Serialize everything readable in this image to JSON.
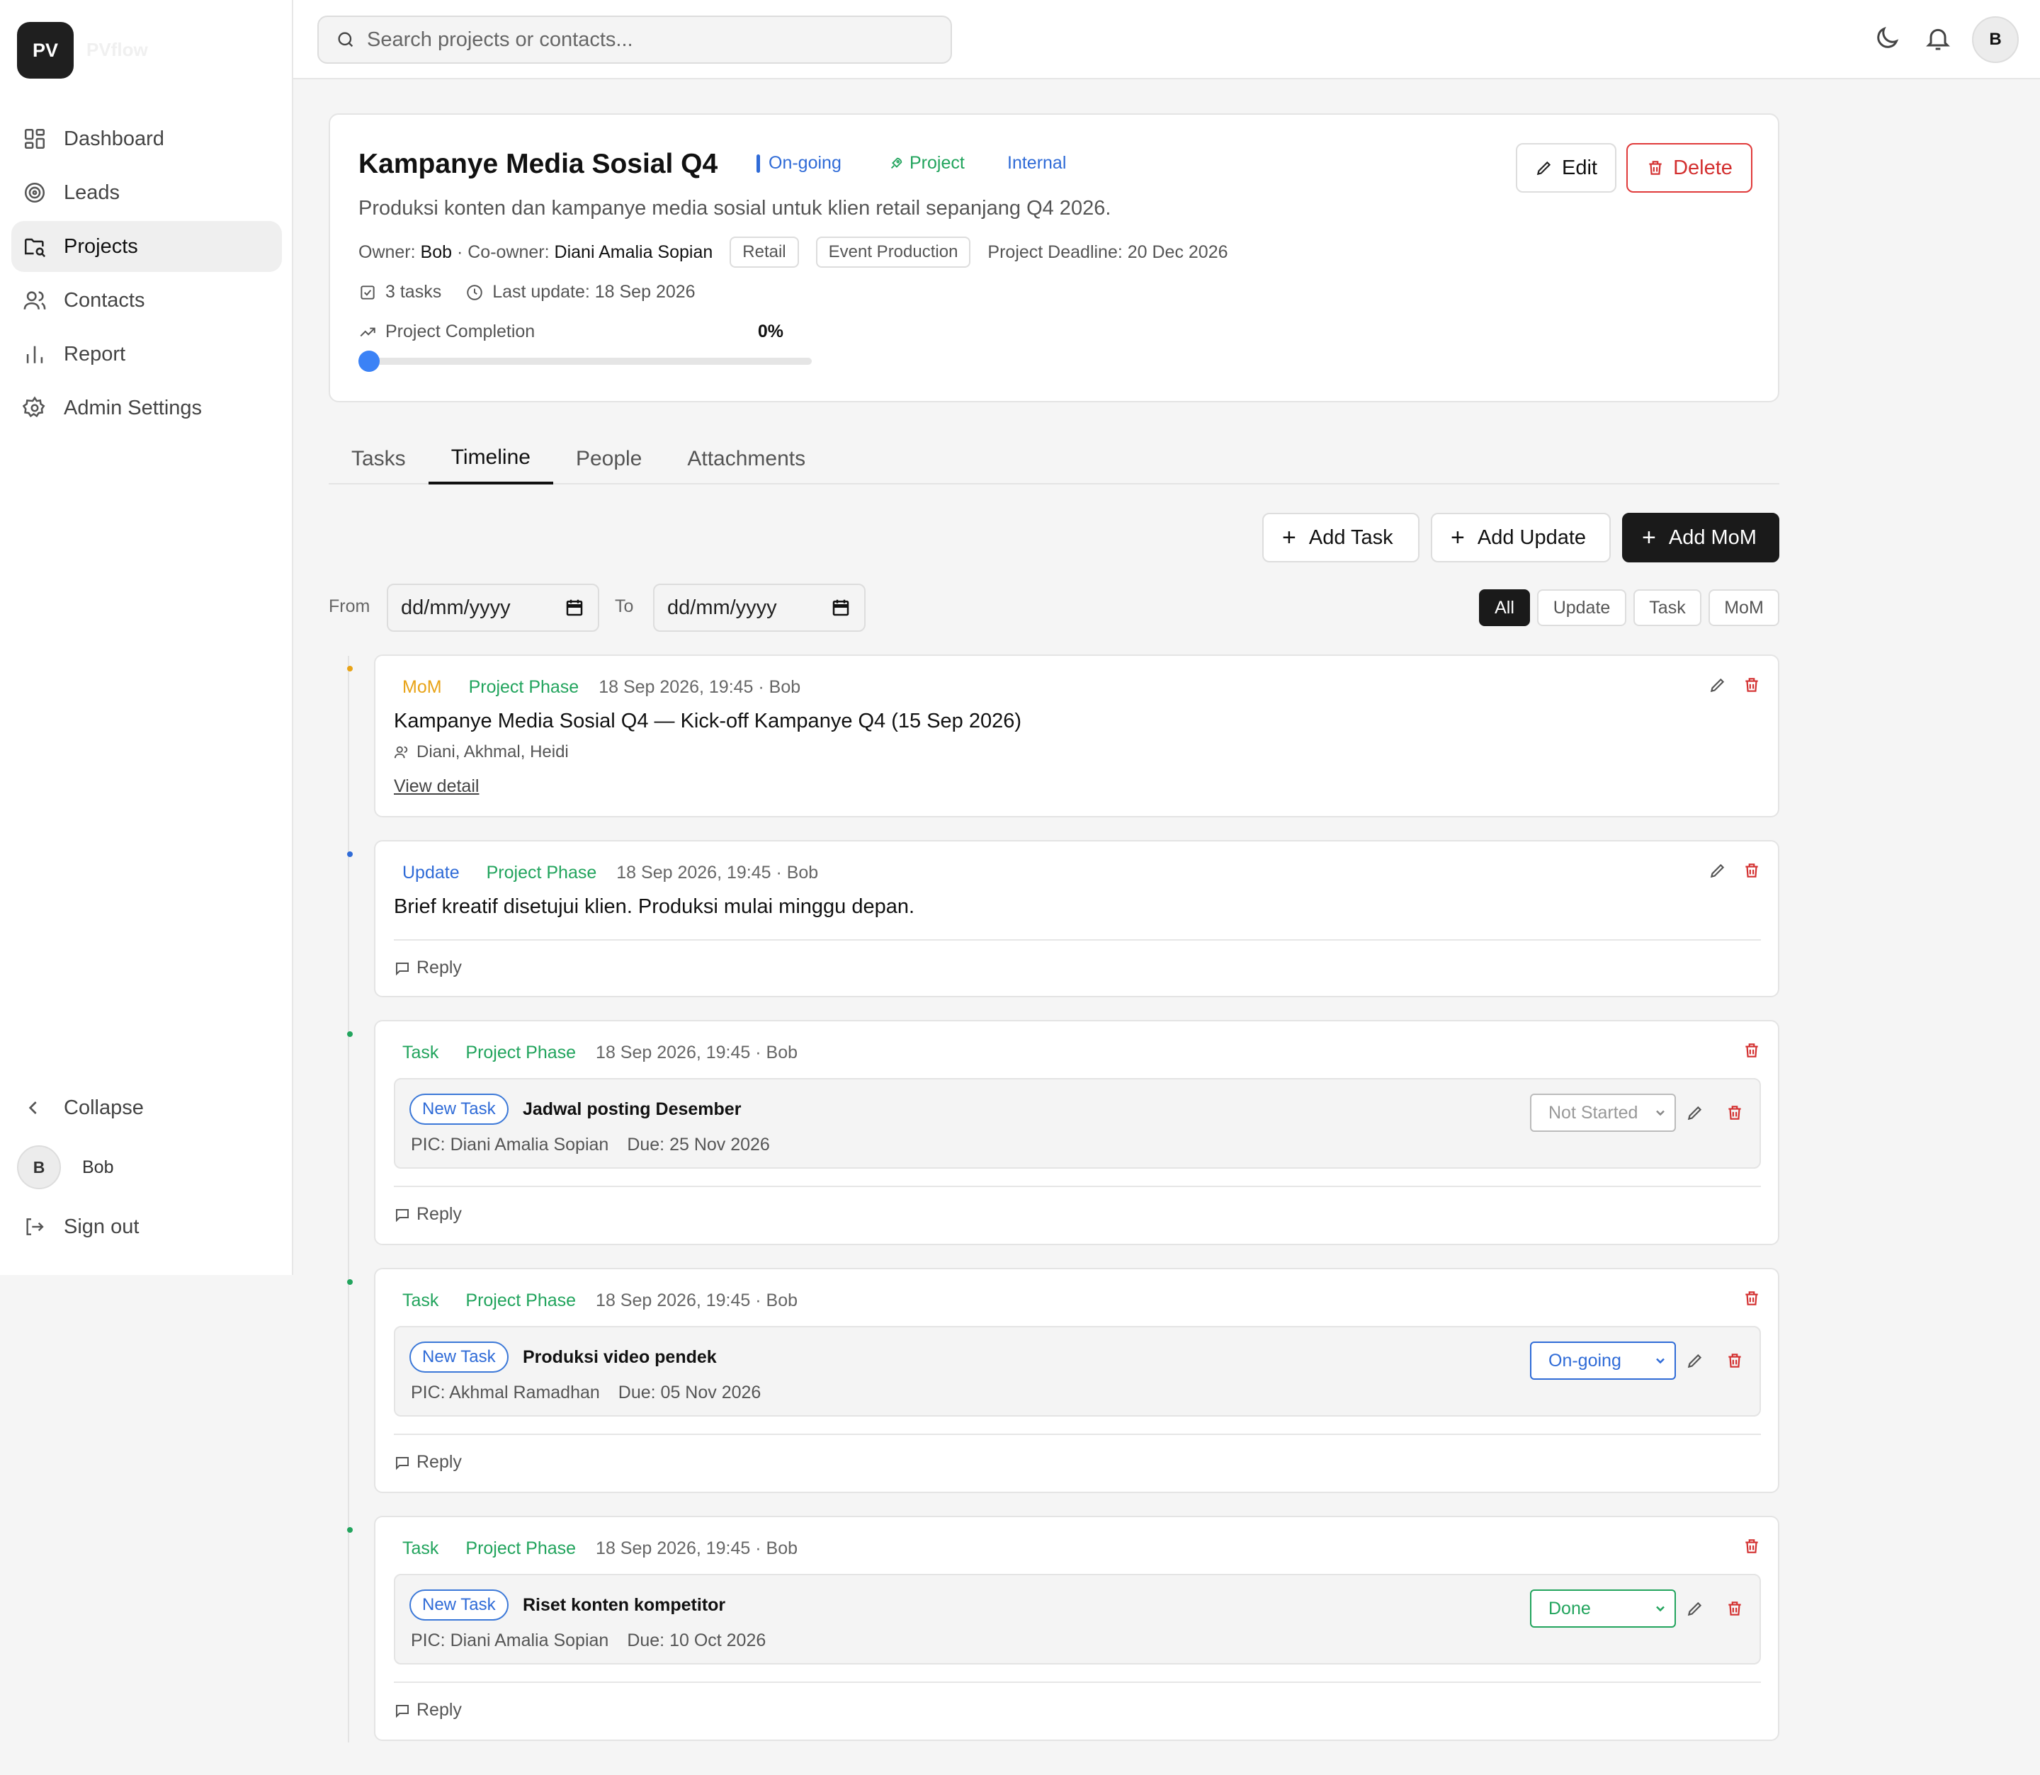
{
  "app": {
    "logo": "PV",
    "logo_text": "PVflow"
  },
  "sidebar": {
    "items": [
      {
        "label": "Dashboard",
        "icon": "dashboard-icon"
      },
      {
        "label": "Leads",
        "icon": "target-icon"
      },
      {
        "label": "Projects",
        "icon": "folder-icon"
      },
      {
        "label": "Contacts",
        "icon": "users-icon"
      },
      {
        "label": "Report",
        "icon": "bar-chart-icon"
      },
      {
        "label": "Admin Settings",
        "icon": "gear-icon"
      }
    ],
    "collapse": "Collapse",
    "user_initial": "B",
    "user_name": "Bob",
    "sign_out": "Sign out"
  },
  "topbar": {
    "search_placeholder": "Search projects or contacts...",
    "avatar": "B"
  },
  "project": {
    "title": "Kampanye Media Sosial Q4",
    "status": "On-going",
    "type": "Project",
    "scope": "Internal",
    "description": "Produksi konten dan kampanye media sosial untuk klien retail sepanjang Q4 2026.",
    "owner_label": "Owner:",
    "owner": "Bob",
    "coowner_label": "· Co-owner:",
    "coowner": "Diani Amalia Sopian",
    "tags": [
      "Retail",
      "Event Production"
    ],
    "deadline": "Project Deadline: 20 Dec 2026",
    "tasks_count": "3 tasks",
    "last_update": "Last update: 18 Sep 2026",
    "completion_label": "Project Completion",
    "completion_text": "0%",
    "completion_value": 0,
    "edit": "Edit",
    "delete": "Delete"
  },
  "tabs": [
    "Tasks",
    "Timeline",
    "People",
    "Attachments"
  ],
  "actions": {
    "add_task": "Add Task",
    "add_update": "Add Update",
    "add_mom": "Add MoM"
  },
  "filters": {
    "from": "From",
    "to": "To",
    "date_placeholder": "dd/mm/yyyy",
    "segments": [
      "All",
      "Update",
      "Task",
      "MoM"
    ]
  },
  "colors": {
    "mom": "#e8a317",
    "update": "#2f6bd7",
    "task": "#22a45d",
    "danger": "#d32f2f"
  },
  "timeline": [
    {
      "type": "MoM",
      "phase": "Project Phase",
      "time": "18 Sep 2026, 19:45 · Bob",
      "title": "Kampanye Media Sosial Q4 — Kick-off Kampanye Q4 (15 Sep 2026)",
      "people": "Diani, Akhmal, Heidi",
      "link": "View detail"
    },
    {
      "type": "Update",
      "phase": "Project Phase",
      "time": "18 Sep 2026, 19:45 · Bob",
      "text": "Brief kreatif disetujui klien. Produksi mulai minggu depan.",
      "reply": "Reply"
    },
    {
      "type": "Task",
      "phase": "Project Phase",
      "time": "18 Sep 2026, 19:45 · Bob",
      "badge": "New Task",
      "name": "Jadwal posting Desember",
      "pic": "PIC: Diani Amalia Sopian",
      "due": "Due: 25 Nov 2026",
      "status": "Not Started",
      "reply": "Reply"
    },
    {
      "type": "Task",
      "phase": "Project Phase",
      "time": "18 Sep 2026, 19:45 · Bob",
      "badge": "New Task",
      "name": "Produksi video pendek",
      "pic": "PIC: Akhmal Ramadhan",
      "due": "Due: 05 Nov 2026",
      "status": "On-going",
      "reply": "Reply"
    },
    {
      "type": "Task",
      "phase": "Project Phase",
      "time": "18 Sep 2026, 19:45 · Bob",
      "badge": "New Task",
      "name": "Riset konten kompetitor",
      "pic": "PIC: Diani Amalia Sopian",
      "due": "Due: 10 Oct 2026",
      "status": "Done",
      "reply": "Reply"
    }
  ]
}
